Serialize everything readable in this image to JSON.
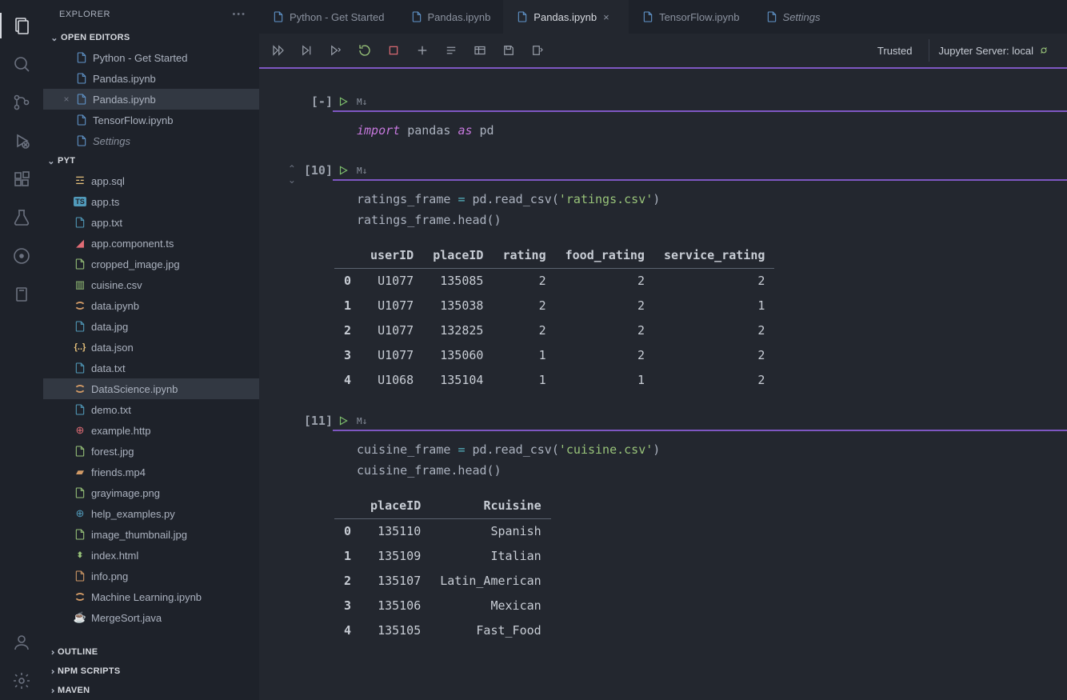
{
  "explorer": {
    "title": "EXPLORER",
    "openEditorsLabel": "OPEN EDITORS",
    "openEditors": [
      {
        "label": "Python - Get Started",
        "icon": "file-generic"
      },
      {
        "label": "Pandas.ipynb",
        "icon": "file-generic"
      },
      {
        "label": "Pandas.ipynb",
        "icon": "file-generic",
        "active": true,
        "closeable": true
      },
      {
        "label": "TensorFlow.ipynb",
        "icon": "file-generic"
      },
      {
        "label": "Settings",
        "icon": "file-generic",
        "italic": true
      }
    ],
    "folderLabel": "PYT",
    "files": [
      {
        "label": "app.sql",
        "iconColor": "#e5c07b",
        "iconType": "db"
      },
      {
        "label": "app.ts",
        "iconColor": "#519aba",
        "iconType": "ts"
      },
      {
        "label": "app.txt",
        "iconColor": "#519aba",
        "iconType": "text"
      },
      {
        "label": "app.component.ts",
        "iconColor": "#e06c75",
        "iconType": "angular"
      },
      {
        "label": "cropped_image.jpg",
        "iconColor": "#98c379",
        "iconType": "image"
      },
      {
        "label": "cuisine.csv",
        "iconColor": "#98c379",
        "iconType": "csv"
      },
      {
        "label": "data.ipynb",
        "iconColor": "#d19a66",
        "iconType": "jupyter"
      },
      {
        "label": "data.jpg",
        "iconColor": "#519aba",
        "iconType": "image"
      },
      {
        "label": "data.json",
        "iconColor": "#e5c07b",
        "iconType": "json"
      },
      {
        "label": "data.txt",
        "iconColor": "#519aba",
        "iconType": "text"
      },
      {
        "label": "DataScience.ipynb",
        "iconColor": "#d19a66",
        "iconType": "jupyter",
        "active": true
      },
      {
        "label": "demo.txt",
        "iconColor": "#519aba",
        "iconType": "text"
      },
      {
        "label": "example.http",
        "iconColor": "#e06c75",
        "iconType": "http"
      },
      {
        "label": "forest.jpg",
        "iconColor": "#98c379",
        "iconType": "image"
      },
      {
        "label": "friends.mp4",
        "iconColor": "#d19a66",
        "iconType": "video"
      },
      {
        "label": "grayimage.png",
        "iconColor": "#98c379",
        "iconType": "image"
      },
      {
        "label": "help_examples.py",
        "iconColor": "#519aba",
        "iconType": "python"
      },
      {
        "label": "image_thumbnail.jpg",
        "iconColor": "#98c379",
        "iconType": "image"
      },
      {
        "label": "index.html",
        "iconColor": "#98c379",
        "iconType": "html"
      },
      {
        "label": "info.png",
        "iconColor": "#d19a66",
        "iconType": "image"
      },
      {
        "label": "Machine Learning.ipynb",
        "iconColor": "#d19a66",
        "iconType": "jupyter"
      },
      {
        "label": "MergeSort.java",
        "iconColor": "#e06c75",
        "iconType": "java"
      }
    ],
    "outlineLabel": "OUTLINE",
    "npmScriptsLabel": "NPM SCRIPTS",
    "mavenLabel": "MAVEN"
  },
  "tabs": [
    {
      "label": "Python - Get Started"
    },
    {
      "label": "Pandas.ipynb"
    },
    {
      "label": "Pandas.ipynb",
      "active": true,
      "closeable": true
    },
    {
      "label": "TensorFlow.ipynb"
    },
    {
      "label": "Settings",
      "italic": true
    }
  ],
  "toolbar": {
    "trusted": "Trusted",
    "server": "Jupyter Server: local"
  },
  "cells": [
    {
      "exec": "[-]",
      "markdownLabel": "M↓",
      "codeHtml": "<span class='kw'>import</span> pandas <span class='kw2'>as</span> pd",
      "hasUpDown": false
    },
    {
      "exec": "[10]",
      "markdownLabel": "M↓",
      "codeHtml": "ratings_frame <span class='op'>=</span> pd.read_csv(<span class='str'>'ratings.csv'</span>)\nratings_frame.head()",
      "hasUpDown": true,
      "output": {
        "headers": [
          "",
          "userID",
          "placeID",
          "rating",
          "food_rating",
          "service_rating"
        ],
        "rows": [
          [
            "0",
            "U1077",
            "135085",
            "2",
            "2",
            "2"
          ],
          [
            "1",
            "U1077",
            "135038",
            "2",
            "2",
            "1"
          ],
          [
            "2",
            "U1077",
            "132825",
            "2",
            "2",
            "2"
          ],
          [
            "3",
            "U1077",
            "135060",
            "1",
            "2",
            "2"
          ],
          [
            "4",
            "U1068",
            "135104",
            "1",
            "1",
            "2"
          ]
        ]
      }
    },
    {
      "exec": "[11]",
      "markdownLabel": "M↓",
      "codeHtml": "cuisine_frame <span class='op'>=</span> pd.read_csv(<span class='str'>'cuisine.csv'</span>)\ncuisine_frame.head()",
      "hasUpDown": false,
      "output": {
        "headers": [
          "",
          "placeID",
          "Rcuisine"
        ],
        "rows": [
          [
            "0",
            "135110",
            "Spanish"
          ],
          [
            "1",
            "135109",
            "Italian"
          ],
          [
            "2",
            "135107",
            "Latin_American"
          ],
          [
            "3",
            "135106",
            "Mexican"
          ],
          [
            "4",
            "135105",
            "Fast_Food"
          ]
        ]
      }
    }
  ]
}
